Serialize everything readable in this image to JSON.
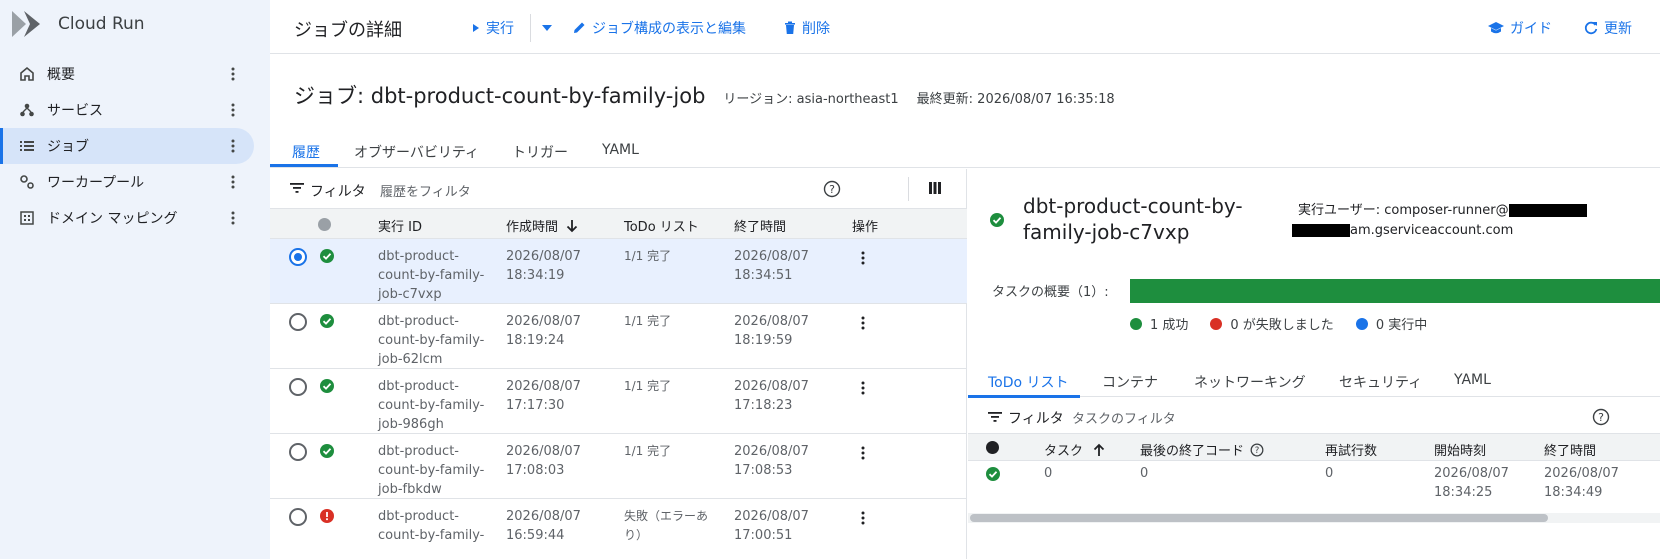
{
  "sidebar": {
    "brand": "Cloud Run",
    "items": [
      {
        "label": "概要",
        "icon": "home-icon"
      },
      {
        "label": "サービス",
        "icon": "services-icon"
      },
      {
        "label": "ジョブ",
        "icon": "list-icon",
        "active": true
      },
      {
        "label": "ワーカープール",
        "icon": "gears-icon"
      },
      {
        "label": "ドメイン マッピング",
        "icon": "building-icon"
      }
    ]
  },
  "topbar": {
    "title": "ジョブの詳細",
    "run_label": "実行",
    "edit_label": "ジョブ構成の表示と編集",
    "delete_label": "削除",
    "guide_label": "ガイド",
    "refresh_label": "更新"
  },
  "job": {
    "title": "ジョブ: dbt-product-count-by-family-job",
    "region": "リージョン: asia-northeast1",
    "updated": "最終更新: 2026/08/07 16:35:18"
  },
  "tabs": [
    "履歴",
    "オブザーバビリティ",
    "トリガー",
    "YAML"
  ],
  "history": {
    "filter_label": "フィルタ",
    "filter_placeholder": "履歴をフィルタ",
    "headers": {
      "id": "実行 ID",
      "created": "作成時間",
      "todo": "ToDo リスト",
      "end": "終了時間",
      "actions": "操作"
    },
    "rows": [
      {
        "id": "dbt-product-count-by-family-job-c7vxp",
        "created": "2026/08/07 18:34:19",
        "todo": "1/1 完了",
        "end": "2026/08/07 18:34:51",
        "status": "success",
        "selected": true
      },
      {
        "id": "dbt-product-count-by-family-job-62lcm",
        "created": "2026/08/07 18:19:24",
        "todo": "1/1 完了",
        "end": "2026/08/07 18:19:59",
        "status": "success",
        "selected": false
      },
      {
        "id": "dbt-product-count-by-family-job-986gh",
        "created": "2026/08/07 17:17:30",
        "todo": "1/1 完了",
        "end": "2026/08/07 17:18:23",
        "status": "success",
        "selected": false
      },
      {
        "id": "dbt-product-count-by-family-job-fbkdw",
        "created": "2026/08/07 17:08:03",
        "todo": "1/1 完了",
        "end": "2026/08/07 17:08:53",
        "status": "success",
        "selected": false
      },
      {
        "id": "dbt-product-count-by-family-",
        "created": "2026/08/07 16:59:44",
        "todo": "失敗（エラーあり）",
        "end": "2026/08/07 17:00:51",
        "status": "error",
        "selected": false
      }
    ]
  },
  "detail": {
    "title": "dbt-product-count-by-family-job-c7vxp",
    "user_prefix": "実行ユーザー: composer-runner@",
    "user_suffix": "am.gserviceaccount.com",
    "task_summary_label": "タスクの概要（1）:",
    "legend": [
      {
        "label": "1 成功",
        "color": "#1e8e3e"
      },
      {
        "label": "0 が失敗しました",
        "color": "#d93025"
      },
      {
        "label": "0 実行中",
        "color": "#1a73e8"
      }
    ],
    "tabs": [
      "ToDo リスト",
      "コンテナ",
      "ネットワーキング",
      "セキュリティ",
      "YAML"
    ],
    "filter_label": "フィルタ",
    "filter_placeholder": "タスクのフィルタ",
    "headers": {
      "task": "タスク",
      "exit": "最後の終了コード",
      "retries": "再試行数",
      "start": "開始時刻",
      "end": "終了時間"
    },
    "rows": [
      {
        "task": "0",
        "exit": "0",
        "retries": "0",
        "start": "2026/08/07 18:34:25",
        "end": "2026/08/07 18:34:49"
      }
    ]
  },
  "colors": {
    "accent": "#1a73e8",
    "success": "#1e8e3e",
    "error": "#d93025",
    "sidebar_bg": "#eef3fb"
  }
}
